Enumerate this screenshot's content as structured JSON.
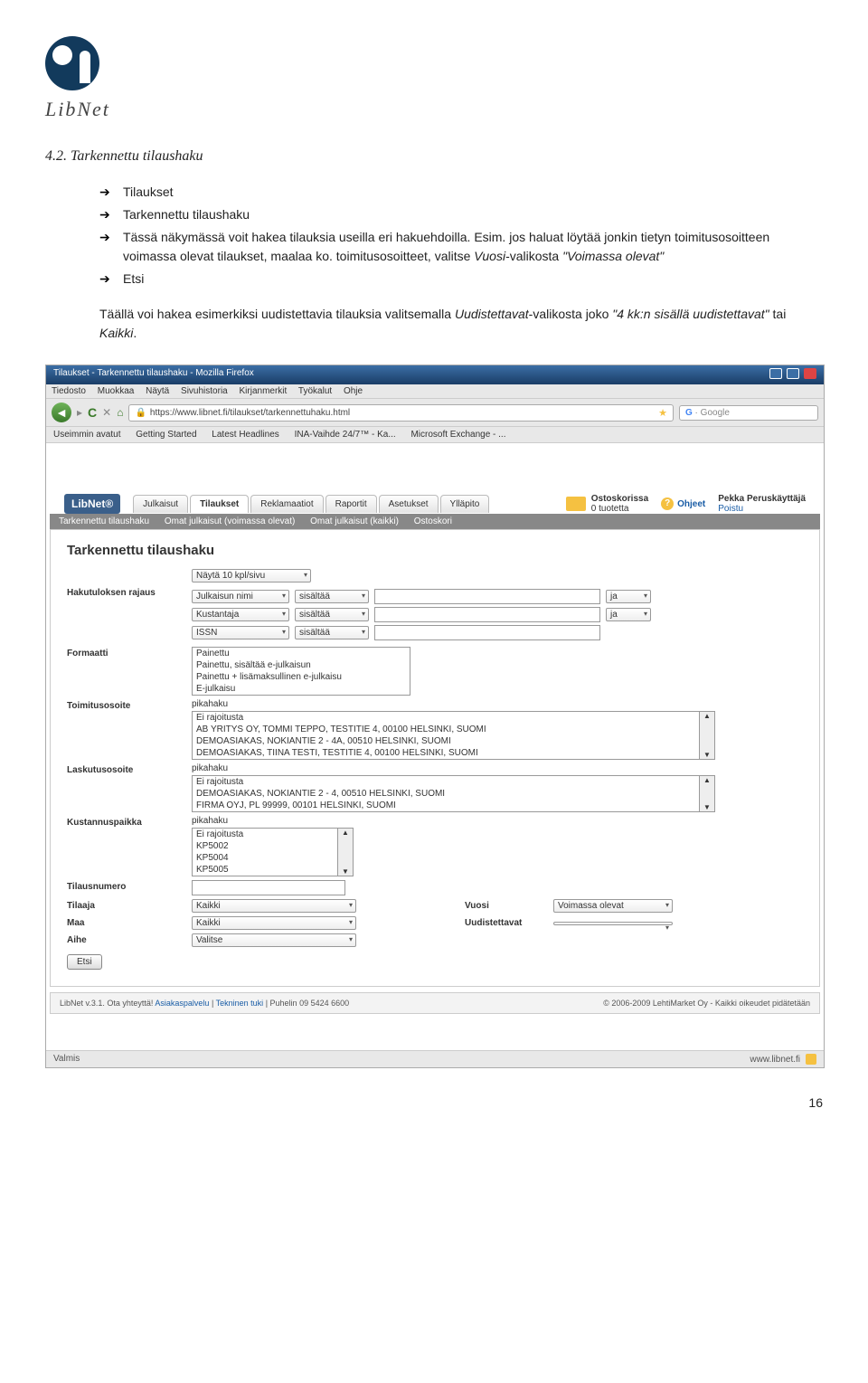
{
  "logo_text": "LibNet",
  "section_heading": "4.2. Tarkennettu tilaushaku",
  "bullets": [
    "Tilaukset",
    "Tarkennettu tilaushaku",
    "Tässä näkymässä voit hakea tilauksia useilla eri hakuehdoilla. Esim. jos haluat löytää jonkin tietyn toimitusosoitteen voimassa olevat tilaukset, maalaa ko. toimitusosoitteet, valitse ",
    "Etsi"
  ],
  "bullet3_ital1": "Vuosi",
  "bullet3_mid": "-valikosta ",
  "bullet3_ital2": "\"Voimassa olevat\"",
  "para_pre": "Täällä voi hakea esimerkiksi uudistettavia tilauksia valitsemalla ",
  "para_i1": "Uudistettavat",
  "para_mid": "-valikosta joko ",
  "para_i2": "\"4 kk:n sisällä uudistettavat\"",
  "para_mid2": " tai ",
  "para_i3": "Kaikki",
  "para_end": ".",
  "browser": {
    "title": "Tilaukset - Tarkennettu tilaushaku - Mozilla Firefox",
    "menus": [
      "Tiedosto",
      "Muokkaa",
      "Näytä",
      "Sivuhistoria",
      "Kirjanmerkit",
      "Työkalut",
      "Ohje"
    ],
    "url": "https://www.libnet.fi/tilaukset/tarkennettuhaku.html",
    "search_hint": "Google",
    "bookmarks": [
      "Useimmin avatut",
      "Getting Started",
      "Latest Headlines",
      "INA-Vaihde 24/7™ - Ka...",
      "Microsoft Exchange - ..."
    ],
    "status_left": "Valmis",
    "status_right": "www.libnet.fi"
  },
  "libnet": {
    "brand": "LibNet®",
    "tabs": [
      "Julkaisut",
      "Tilaukset",
      "Reklamaatiot",
      "Raportit",
      "Asetukset",
      "Ylläpito"
    ],
    "cart_l1": "Ostoskorissa",
    "cart_l2": "0 tuotetta",
    "help": "Ohjeet",
    "user": "Pekka Peruskäyttäjä",
    "logout": "Poistu",
    "subnav": [
      "Tarkennettu tilaushaku",
      "Omat julkaisut (voimassa olevat)",
      "Omat julkaisut (kaikki)",
      "Ostoskori"
    ],
    "form_title": "Tarkennettu tilaushaku",
    "show": "Näytä 10 kpl/sivu",
    "labels": {
      "rajaus": "Hakutuloksen rajaus",
      "formaatti": "Formaatti",
      "toimitus": "Toimitusosoite",
      "laskutus": "Laskutusosoite",
      "kustannus": "Kustannuspaikka",
      "tilausnro": "Tilausnumero",
      "tilaaja": "Tilaaja",
      "maa": "Maa",
      "aihe": "Aihe",
      "vuosi": "Vuosi",
      "uudistettavat": "Uudistettavat"
    },
    "rajaus_rows": [
      {
        "c1": "Julkaisun nimi",
        "c2": "sisältää",
        "c3": "ja"
      },
      {
        "c1": "Kustantaja",
        "c2": "sisältää",
        "c3": "ja"
      },
      {
        "c1": "ISSN",
        "c2": "sisältää",
        "c3": ""
      }
    ],
    "formaatti_opts": [
      "Painettu",
      "Painettu, sisältää e-julkaisun",
      "Painettu + lisämaksullinen e-julkaisu",
      "E-julkaisu"
    ],
    "pikahaku": "pikahaku",
    "toimitus_opts": [
      "Ei rajoitusta",
      "AB YRITYS OY, TOMMI TEPPO, TESTITIE 4, 00100 HELSINKI, SUOMI",
      "DEMOASIAKAS, NOKIANTIE 2 - 4A, 00510 HELSINKI, SUOMI",
      "DEMOASIAKAS, TIINA TESTI, TESTITIE 4, 00100 HELSINKI, SUOMI"
    ],
    "laskutus_opts": [
      "Ei rajoitusta",
      "DEMOASIAKAS, NOKIANTIE 2 - 4, 00510 HELSINKI, SUOMI",
      "FIRMA OYJ, PL 99999, 00101 HELSINKI, SUOMI"
    ],
    "kustannus_opts": [
      "Ei rajoitusta",
      "KP5002",
      "KP5004",
      "KP5005"
    ],
    "tilaaja_val": "Kaikki",
    "maa_val": "Kaikki",
    "aihe_val": "Valitse",
    "vuosi_val": "Voimassa olevat",
    "etsi": "Etsi",
    "footer_left_1": "LibNet v.3.1. Ota yhteyttä! ",
    "footer_link1": "Asiakaspalvelu",
    "footer_sep": " | ",
    "footer_link2": "Tekninen tuki",
    "footer_left_2": " | Puhelin 09 5424 6600",
    "footer_right": "© 2006-2009 LehtiMarket Oy - Kaikki oikeudet pidätetään"
  },
  "page_number": "16"
}
